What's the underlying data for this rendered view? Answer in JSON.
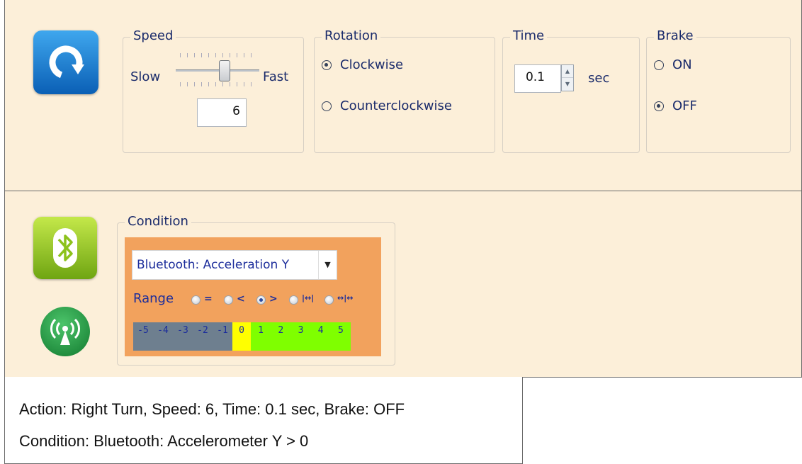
{
  "action": {
    "icon": "rotate-clockwise-icon",
    "speed": {
      "title": "Speed",
      "min_label": "Slow",
      "max_label": "Fast",
      "value": "6",
      "slider_fraction": 0.6
    },
    "rotation": {
      "title": "Rotation",
      "options": [
        "Clockwise",
        "Counterclockwise"
      ],
      "selected": "Clockwise"
    },
    "time": {
      "title": "Time",
      "value": "0.1",
      "unit": "sec"
    },
    "brake": {
      "title": "Brake",
      "options": [
        "ON",
        "OFF"
      ],
      "selected": "OFF"
    }
  },
  "condition": {
    "bt_icon": "bluetooth-icon",
    "wireless_icon": "wireless-signal-icon",
    "title": "Condition",
    "source": "Bluetooth: Acceleration Y",
    "range_label": "Range",
    "range_ops": [
      "=",
      "<",
      ">",
      "|↔|",
      "↔|↔"
    ],
    "range_selected": ">",
    "scale_values": [
      "-5",
      "-4",
      "-3",
      "-2",
      "-1",
      "0",
      "1",
      "2",
      "3",
      "4",
      "5"
    ],
    "colors": {
      "negative": "#6e7f8f",
      "zero": "#ffff00",
      "positive": "#7fff00",
      "panel": "#f2a25d"
    }
  },
  "summary": {
    "line1": "Action: Right Turn, Speed: 6, Time: 0.1 sec, Brake: OFF",
    "line2": "Condition: Bluetooth: Accelerometer Y > 0"
  }
}
